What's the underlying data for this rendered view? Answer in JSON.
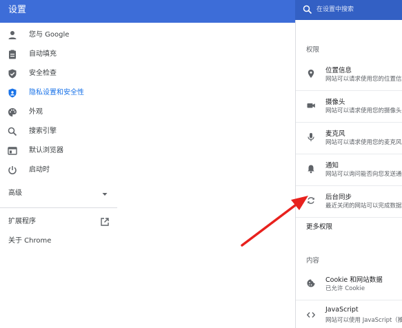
{
  "header": {
    "title": "设置",
    "search_placeholder": "在设置中搜索"
  },
  "sidebar": {
    "items": [
      {
        "label": "您与 Google",
        "icon": "person-icon"
      },
      {
        "label": "自动填充",
        "icon": "clipboard-icon"
      },
      {
        "label": "安全检查",
        "icon": "shield-check-icon"
      },
      {
        "label": "隐私设置和安全性",
        "icon": "shield-icon",
        "active": true
      },
      {
        "label": "外观",
        "icon": "palette-icon"
      },
      {
        "label": "搜索引擎",
        "icon": "search-icon"
      },
      {
        "label": "默认浏览器",
        "icon": "browser-icon"
      },
      {
        "label": "启动时",
        "icon": "power-icon"
      }
    ],
    "advanced_label": "高级",
    "extensions_label": "扩展程序",
    "about_label": "关于 Chrome"
  },
  "main": {
    "permissions_heading": "权限",
    "permissions": [
      {
        "title": "位置信息",
        "desc": "网站可以请求使用您的位置信息",
        "icon": "location-pin-icon"
      },
      {
        "title": "摄像头",
        "desc": "网站可以请求使用您的摄像头",
        "icon": "camera-icon"
      },
      {
        "title": "麦克风",
        "desc": "网站可以请求使用您的麦克风",
        "icon": "microphone-icon"
      },
      {
        "title": "通知",
        "desc": "网站可以询问能否向您发送通知",
        "icon": "bell-icon"
      },
      {
        "title": "后台同步",
        "desc": "最近关闭的网站可以完成数据收发",
        "icon": "sync-icon"
      }
    ],
    "more_permissions_label": "更多权限",
    "content_heading": "内容",
    "content": [
      {
        "title": "Cookie 和网站数据",
        "desc": "已允许 Cookie",
        "icon": "cookie-icon"
      },
      {
        "title": "JavaScript",
        "desc": "网站可以使用 JavaScript（推荐）",
        "icon": "code-icon"
      }
    ]
  },
  "colors": {
    "header": "#3d6dd8",
    "accent": "#1a73e8",
    "annotation_arrow": "#e8211d"
  }
}
